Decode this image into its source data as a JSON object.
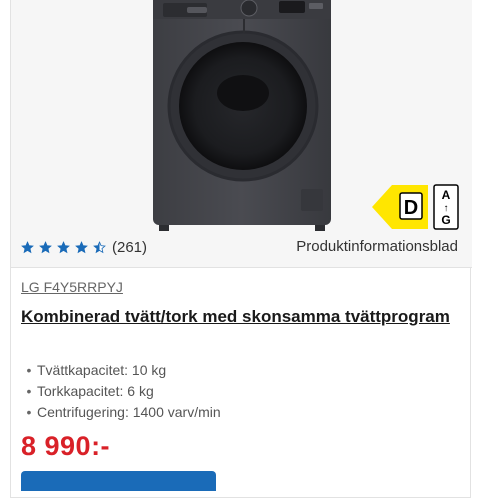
{
  "product": {
    "image_alt": "",
    "rating": {
      "value": 4.5,
      "max": 5,
      "review_count": "(261)"
    },
    "datasheet_link": "Produktinformationsblad",
    "energy_label": {
      "class": "D",
      "scale_top": "A",
      "scale_bottom": "G",
      "color": "#ffe600"
    },
    "model": "LG F4Y5RRPYJ",
    "title": "Kombinerad tvätt/tork med skonsamma tvättprogram",
    "specs": [
      "Tvättkapacitet: 10 kg",
      "Torkkapacitet: 6 kg",
      "Centrifugering: 1400 varv/min"
    ],
    "price": "8 990:-",
    "buy_button_label": ""
  },
  "colors": {
    "price": "#d92128",
    "button": "#1a6bb8",
    "stars": "#1a6bb8"
  }
}
